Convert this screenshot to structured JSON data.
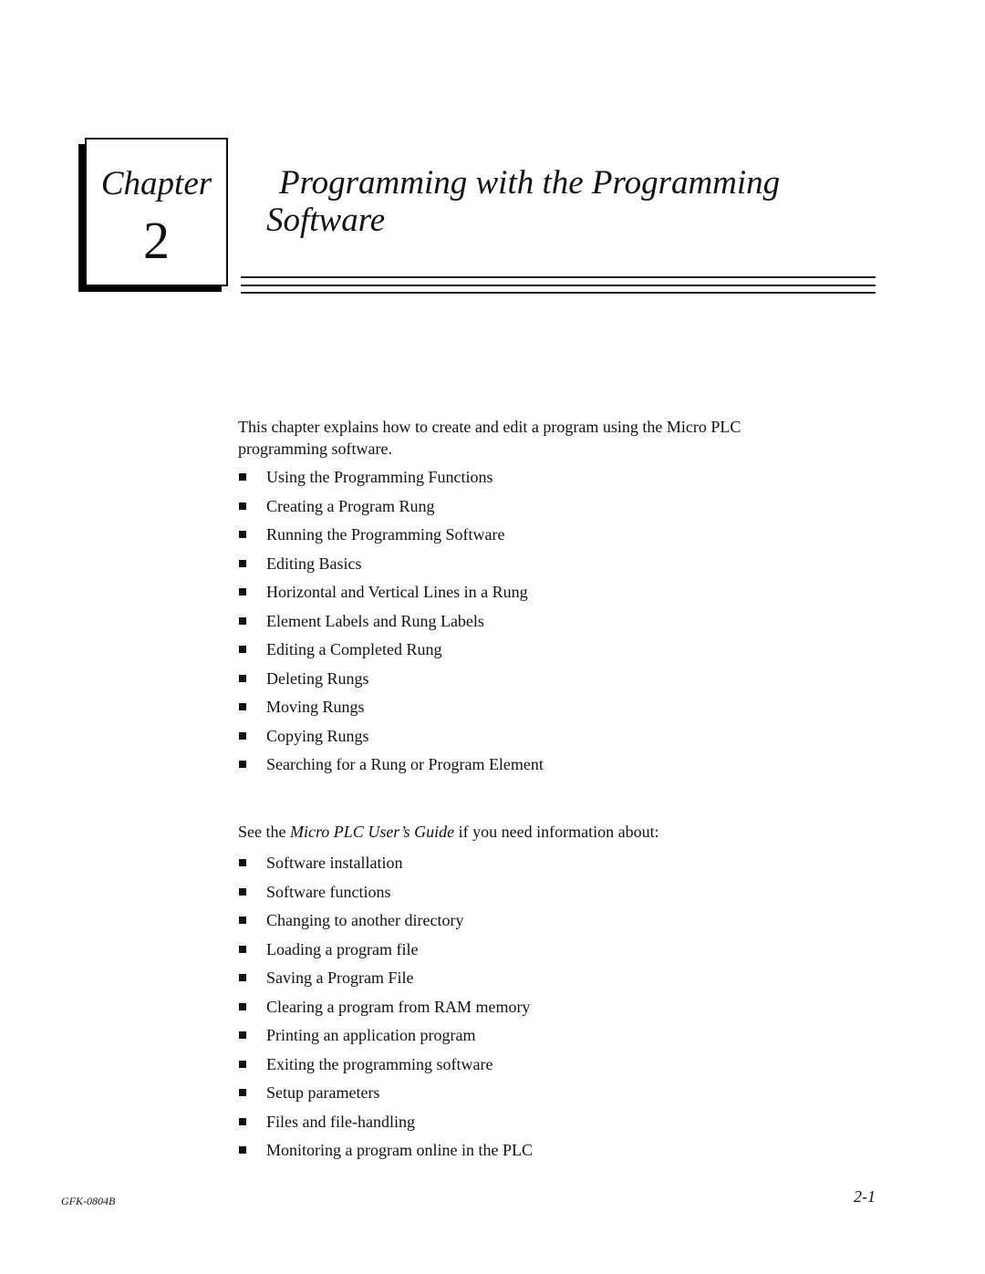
{
  "chapter": {
    "label": "Chapter",
    "number": "2"
  },
  "title": {
    "line1": "Programming with the Programming",
    "line2": "Software"
  },
  "intro": "This chapter explains how to create and edit a program using the Micro PLC programming software.",
  "topics": [
    "Using the Programming Functions",
    "Creating a Program Rung",
    "Running the Programming Software",
    "Editing Basics",
    "Horizontal and Vertical Lines in a Rung",
    "Element Labels and Rung Labels",
    "Editing a Completed Rung",
    "Deleting Rungs",
    "Moving Rungs",
    "Copying Rungs",
    "Searching for a Rung or Program Element"
  ],
  "see_also": {
    "prefix": "See the ",
    "guide_title": "Micro PLC User’s Guide",
    "suffix": " if you need information about:"
  },
  "guide_topics": [
    "Software installation",
    "Software functions",
    "Changing to another directory",
    "Loading a program file",
    "Saving a Program File",
    "Clearing a program from RAM memory",
    "Printing an application program",
    "Exiting the programming software",
    "Setup parameters",
    "Files and file-handling",
    "Monitoring a program online in the PLC"
  ],
  "footer": {
    "doc_id": "GFK-0804B",
    "page_number": "2-1"
  }
}
